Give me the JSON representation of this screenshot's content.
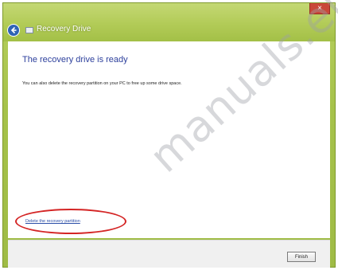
{
  "window": {
    "title": "Recovery Drive",
    "close_label": "×"
  },
  "content": {
    "heading": "The recovery drive is ready",
    "body": "You can also delete the recovery partition on your PC to free up some drive space.",
    "delete_link": "Delete the recovery partition"
  },
  "footer": {
    "finish_label": "Finish"
  },
  "watermark": {
    "text": "manuals.eu"
  },
  "icons": {
    "back": "back-arrow-icon",
    "app": "recovery-drive-icon"
  },
  "colors": {
    "titlebar": "#b2cb57",
    "heading": "#2c3f9c",
    "link": "#2c4fa8",
    "highlight": "#d42525"
  }
}
